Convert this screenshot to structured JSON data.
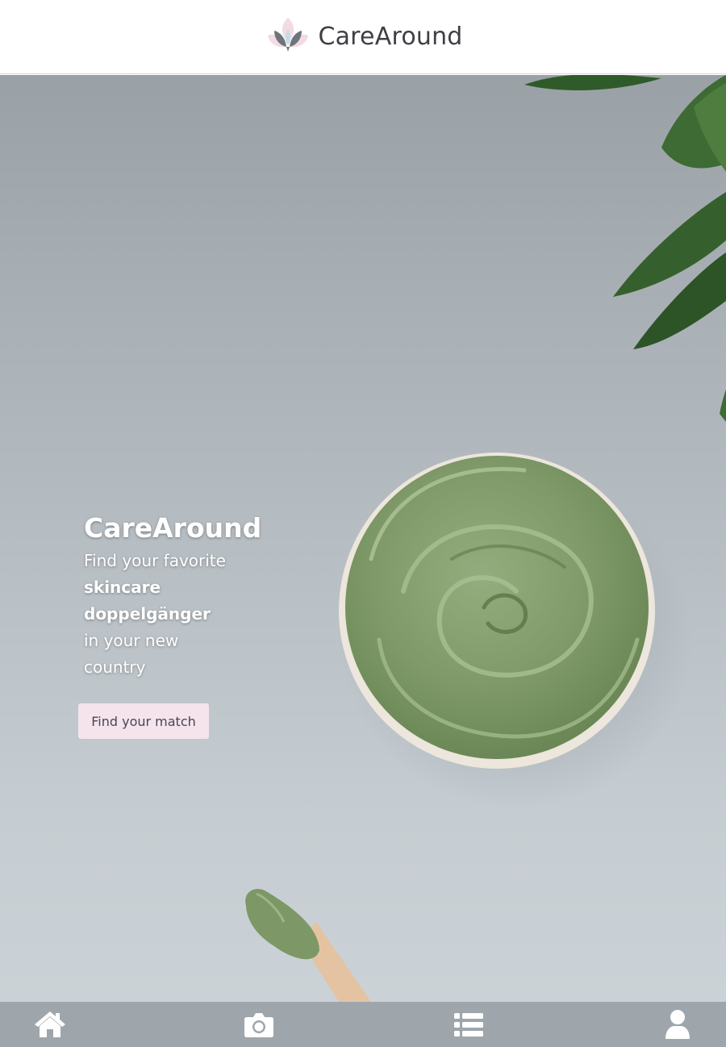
{
  "header": {
    "brand_name": "CareAround",
    "logo_icon": "lotus-logo-icon"
  },
  "hero": {
    "title": "CareAround",
    "line1": "Find your favorite",
    "line2": "skincare",
    "line3": "doppelgänger",
    "line4": "in your new",
    "line5": "country",
    "cta_label": "Find your match"
  },
  "tabbar": {
    "tabs": [
      {
        "icon": "home-icon"
      },
      {
        "icon": "camera-icon"
      },
      {
        "icon": "list-icon"
      },
      {
        "icon": "user-icon"
      }
    ]
  },
  "colors": {
    "header_bg": "#ffffff",
    "brand_text": "#3f3f44",
    "cta_bg": "#f5e4ec",
    "tabbar_bg": "#9ea6ab",
    "clay_green": "#7f9a68"
  }
}
